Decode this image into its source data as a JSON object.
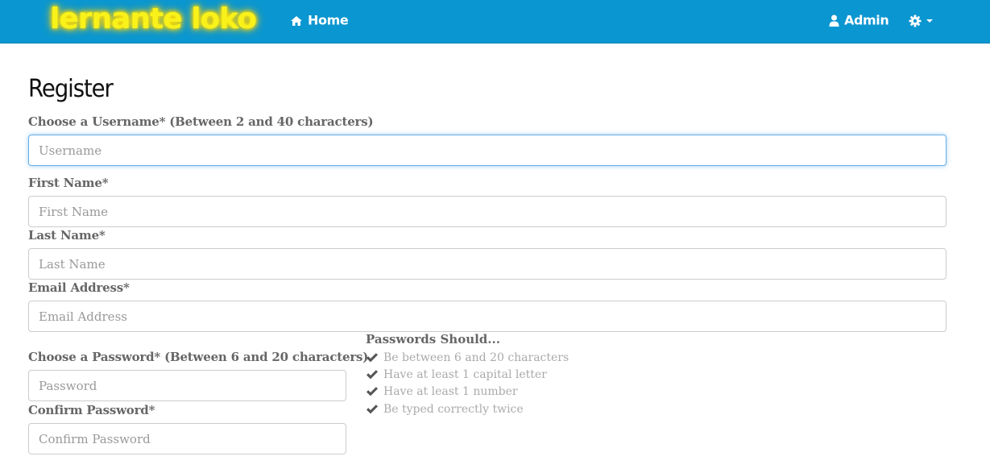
{
  "navbar": {
    "brand": "lernante loko",
    "home_label": "Home",
    "admin_label": "Admin",
    "accent_color": "#0a96d0",
    "brand_color": "#f9f21a",
    "icons": {
      "home": "home-icon",
      "user": "user-icon",
      "settings": "gear-icon"
    }
  },
  "page": {
    "title": "Register"
  },
  "form": {
    "username": {
      "label": "Choose a Username* (Between 2 and 40 characters)",
      "placeholder": "Username",
      "value": ""
    },
    "first_name": {
      "label": "First Name*",
      "placeholder": "First Name",
      "value": ""
    },
    "last_name": {
      "label": "Last Name*",
      "placeholder": "Last Name",
      "value": ""
    },
    "email": {
      "label": "Email Address*",
      "placeholder": "Email Address",
      "value": ""
    },
    "password": {
      "label": "Choose a Password* (Between 6 and 20 characters)",
      "placeholder": "Password",
      "value": ""
    },
    "confirm_password": {
      "label": "Confirm Password*",
      "placeholder": "Confirm Password",
      "value": ""
    }
  },
  "password_rules": {
    "title": "Passwords Should...",
    "items": [
      "Be between 6 and 20 characters",
      "Have at least 1 capital letter",
      "Have at least 1 number",
      "Be typed correctly twice"
    ]
  }
}
